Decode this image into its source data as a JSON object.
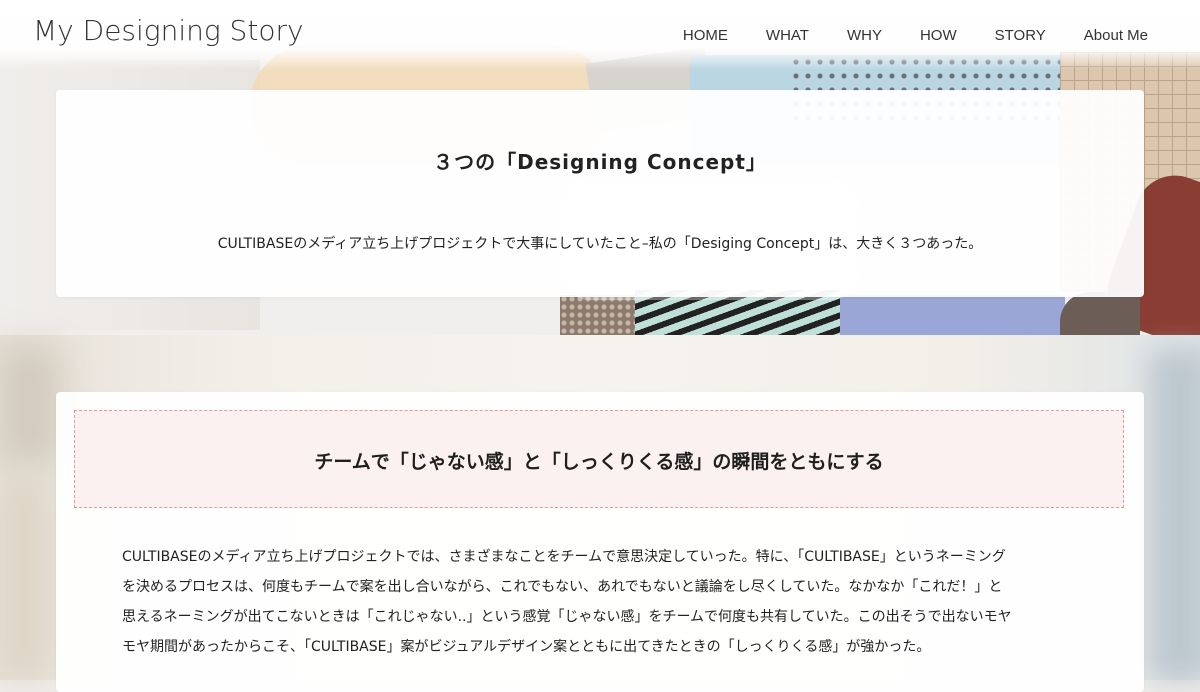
{
  "site": {
    "title": "My Designing Story"
  },
  "nav": {
    "items": [
      {
        "label": "HOME"
      },
      {
        "label": "WHAT"
      },
      {
        "label": "WHY"
      },
      {
        "label": "HOW"
      },
      {
        "label": "STORY"
      },
      {
        "label": "About Me"
      }
    ]
  },
  "hero": {
    "heading": "３つの「Designing Concept」",
    "subtitle": "CULTIBASEのメディア立ち上げプロジェクトで大事にしていたこと–私の「Desiging Concept」は、大きく３つあった。"
  },
  "section1": {
    "heading": "チームで「じゃない感」と「しっくりくる感」の瞬間をともにする",
    "lines": [
      "CULTIBASEのメディア立ち上げプロジェクトでは、さまざまなことをチームで意思決定していった。特に、「CULTIBASE」というネーミング",
      "を決めるプロセスは、何度もチームで案を出し合いながら、これでもない、あれでもないと議論をし尽くしていた。なかなか「これだ！」と",
      "思えるネーミングが出てこないときは「これじゃない..」という感覚「じゃない感」をチームで何度も共有していた。この出そうで出ないモヤ",
      "モヤ期間があったからこそ、「CULTIBASE」案がビジュアルデザイン案とともに出てきたときの「しっくりくる感」が強かった。"
    ]
  }
}
